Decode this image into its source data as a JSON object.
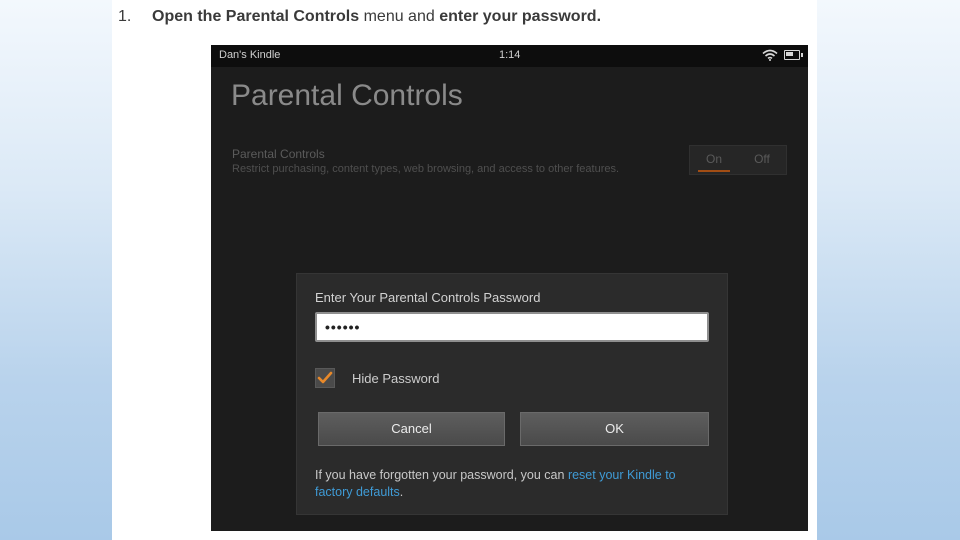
{
  "instruction": {
    "number": "1.",
    "part1": "Open the Parental Controls",
    "part2": " menu and ",
    "part3": "enter your password",
    "part4": "."
  },
  "status_bar": {
    "device_name": "Dan's Kindle",
    "time": "1:14",
    "icons": [
      "wifi-icon",
      "battery-icon"
    ]
  },
  "page": {
    "title": "Parental Controls"
  },
  "setting": {
    "title": "Parental Controls",
    "description": "Restrict purchasing, content types, web browsing, and access to other features.",
    "toggle": {
      "on_label": "On",
      "off_label": "Off",
      "selected": "On"
    }
  },
  "dialog": {
    "title": "Enter Your Parental Controls Password",
    "password_value": "••••••",
    "hide_password_label": "Hide Password",
    "hide_password_checked": true,
    "cancel_label": "Cancel",
    "ok_label": "OK",
    "help_text": "If you have forgotten your password, you can ",
    "help_link": "reset your Kindle to factory defaults",
    "help_end": "."
  },
  "colors": {
    "link": "#3f9bd6",
    "checkmark": "#e8892a",
    "toggle_underline": "#a24d14"
  }
}
